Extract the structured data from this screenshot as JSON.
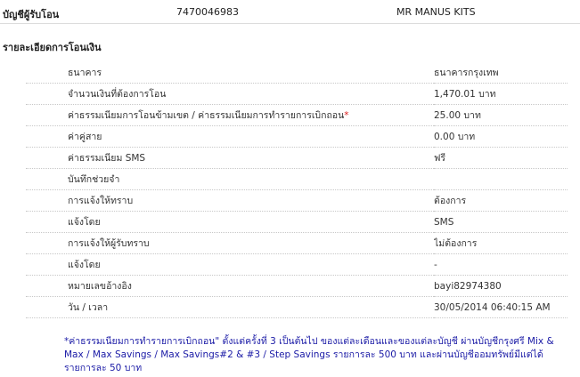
{
  "recipient": {
    "label": "บัญชีผู้รับโอน",
    "account_number": "7470046983",
    "account_name": "MR MANUS KITS"
  },
  "section_title": "รายละเอียดการโอนเงิน",
  "rows": [
    {
      "label": "ธนาคาร",
      "value": "ธนาคารกรุงเทพ"
    },
    {
      "label": "จำนวนเงินที่ต้องการโอน",
      "value": "1,470.01 บาท"
    },
    {
      "label": "ค่าธรรมเนียมการโอนข้ามเขต / ค่าธรรมเนียมการทำรายการเบิกถอน",
      "label_mark": "*",
      "value": "25.00 บาท"
    },
    {
      "label": "ค่าคู่สาย",
      "value": "0.00 บาท"
    },
    {
      "label": "ค่าธรรมเนียม SMS",
      "value": "ฟรี"
    },
    {
      "label": "บันทึกช่วยจำ",
      "value": ""
    },
    {
      "label": "การแจ้งให้ทราบ",
      "value": "ต้องการ"
    },
    {
      "label": "แจ้งโดย",
      "value": "SMS"
    },
    {
      "label": "การแจ้งให้ผู้รับทราบ",
      "value": "ไม่ต้องการ"
    },
    {
      "label": "แจ้งโดย",
      "value": "-"
    },
    {
      "label": "หมายเลขอ้างอิง",
      "value": "bayi82974380"
    },
    {
      "label": "วัน / เวลา",
      "value": "30/05/2014 06:40:15 AM"
    }
  ],
  "footnote": "*ค่าธรรมเนียมการทำรายการเบิกถอน\" ตั้งแต่ครั้งที่ 3 เป็นต้นไป ของแต่ละเดือนและของแต่ละบัญชี ผ่านบัญชีกรุงศรี Mix & Max / Max Savings / Max Savings#2 & #3 / Step Savings รายการละ 500 บาท และผ่านบัญชีออมทรัพย์มีแต่ได้ รายการละ 50 บาท",
  "colors": {
    "footnote_text": "#1a1aa6",
    "required_mark": "#dd2222",
    "row_border": "#c8c8c8"
  }
}
